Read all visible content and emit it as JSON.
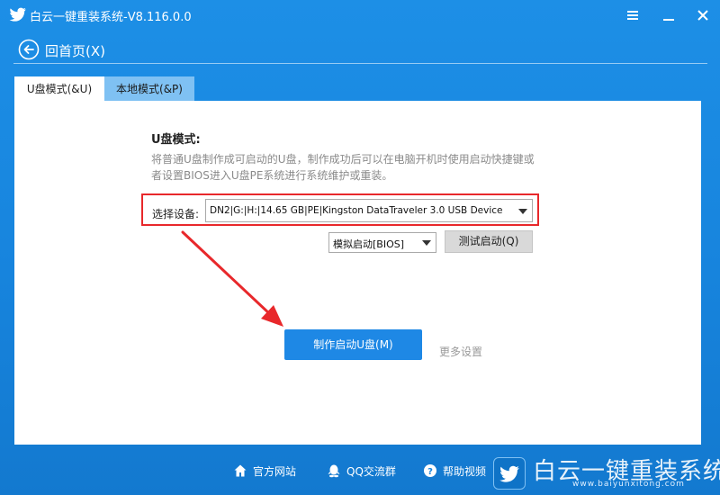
{
  "window": {
    "title": "白云一键重装系统-V8.116.0.0",
    "controls": [
      "menu-icon",
      "minimize-icon",
      "close-icon"
    ]
  },
  "nav": {
    "back_label": "回首页(X)"
  },
  "tabs": [
    {
      "label": "U盘模式(&U)",
      "active": true
    },
    {
      "label": "本地模式(&P)",
      "active": false
    }
  ],
  "usb_mode": {
    "title": "U盘模式:",
    "description": "将普通U盘制作成可启动的U盘，制作成功后可以在电脑开机时使用启动快捷键或者设置BIOS进入U盘PE系统进行系统维护或重装。",
    "device_label": "选择设备:",
    "device_value": "DN2|G:|H:|14.65 GB|PE|Kingston DataTraveler 3.0 USB Device",
    "boot_mode_value": "模拟启动[BIOS]",
    "test_button": "测试启动(Q)",
    "make_button": "制作启动U盘(M)",
    "more_settings": "更多设置"
  },
  "footer": {
    "links": [
      {
        "label": "官方网站",
        "icon": "home-icon"
      },
      {
        "label": "QQ交流群",
        "icon": "qq-icon"
      },
      {
        "label": "帮助视频",
        "icon": "help-icon"
      }
    ],
    "brand_name": "白云一键重装系统",
    "brand_url": "www.baiyunxitong.com"
  },
  "colors": {
    "accent": "#1e88e5",
    "highlight_border": "#e8282b",
    "annotation_arrow": "#e8282b"
  }
}
